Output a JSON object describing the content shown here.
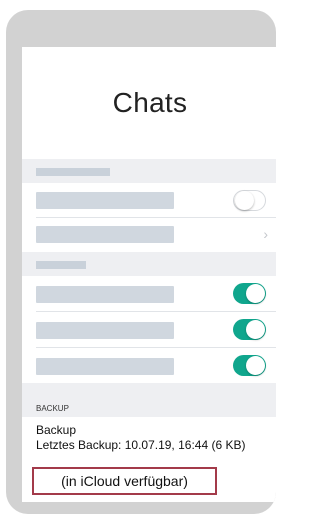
{
  "screen": {
    "title": "Chats"
  },
  "toggles": {
    "row1": "off",
    "row3": "on",
    "row4": "on",
    "row5": "on"
  },
  "backup": {
    "section_header": "BACKUP",
    "title": "Backup",
    "last_backup": "Letztes Backup: 10.07.19, 16:44 (6 KB)",
    "icloud_note": "(in iCloud verfügbar)"
  },
  "icons": {
    "row2_icon": "chevron-right-icon"
  },
  "colors": {
    "toggle_on": "#10a68d",
    "highlight_border": "#a33a4a",
    "placeholder_bar": "#d0d7df",
    "section_bg": "#eeeff2"
  }
}
